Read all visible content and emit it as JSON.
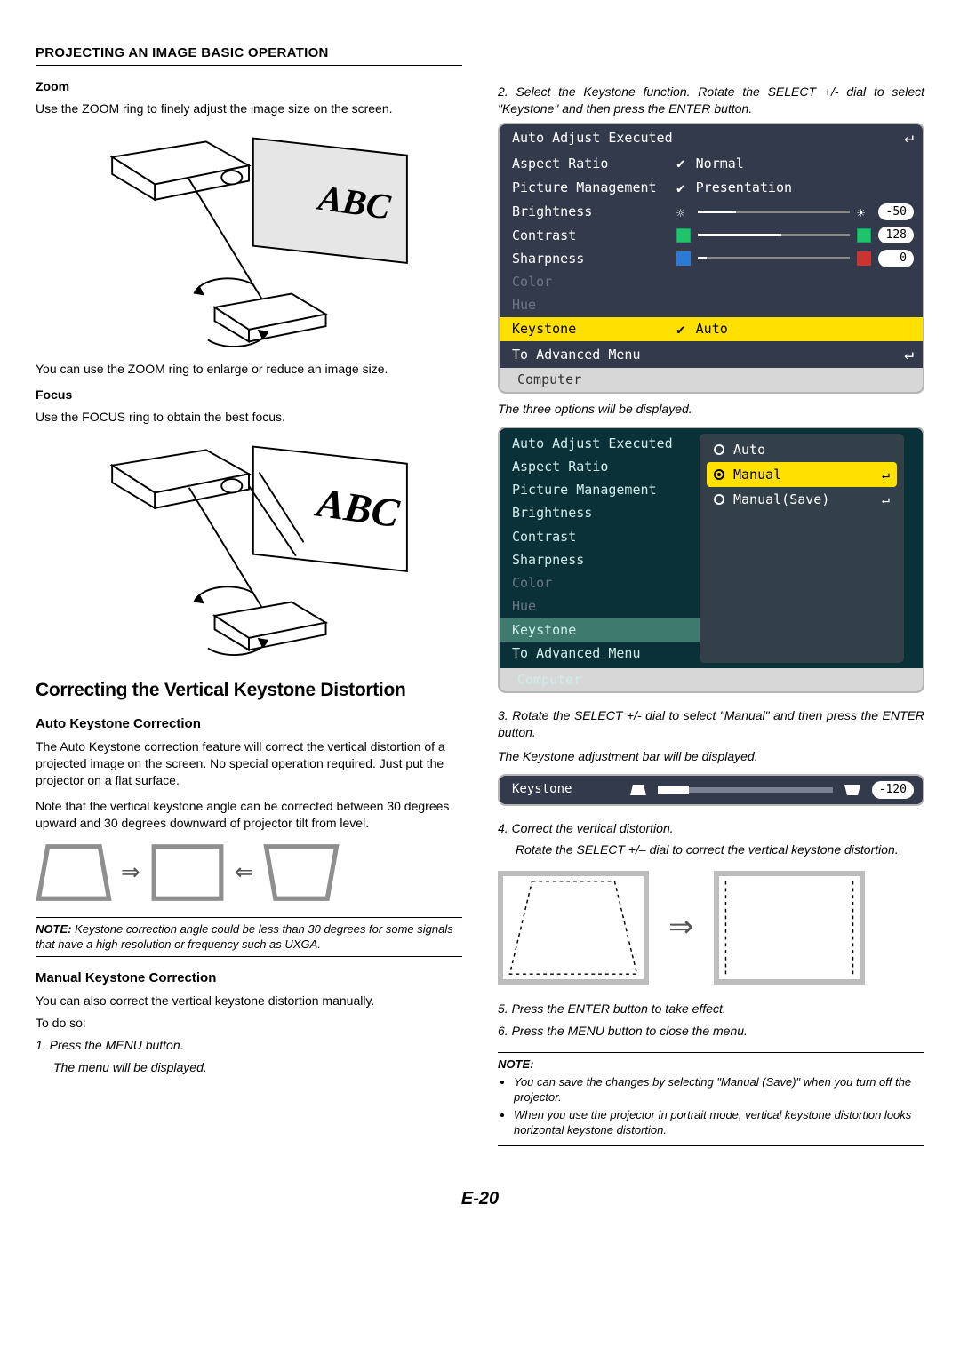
{
  "header": "PROJECTING AN IMAGE BASIC OPERATION",
  "left": {
    "zoom_h": "Zoom",
    "zoom_p": "Use the ZOOM ring to finely adjust the image size on the screen.",
    "zoom_cap": "You can use the ZOOM ring to enlarge or reduce an image size.",
    "focus_h": "Focus",
    "focus_p": "Use the FOCUS ring to obtain the best focus.",
    "big_h": "Correcting the Vertical Keystone Distortion",
    "auto_h": "Auto Keystone Correction",
    "auto_p1": "The Auto Keystone correction feature will correct the vertical distortion of a projected image on the screen. No special operation required. Just put the projector on a flat surface.",
    "auto_p2": "Note that the vertical keystone angle can be corrected between 30 degrees upward and 30 degrees downward of projector tilt from level.",
    "note1_label": "NOTE:",
    "note1_text": " Keystone correction angle could be less than 30 degrees for some signals that have a high resolution or frequency such as UXGA.",
    "manual_h": "Manual Keystone Correction",
    "manual_p1": "You can also correct the vertical keystone distortion manually.",
    "manual_p2": "To do so:",
    "step1a": "1.  Press the MENU button.",
    "step1b": "The menu will be displayed."
  },
  "right": {
    "step2": "2. Select the Keystone function. Rotate the SELECT +/- dial to select \"Keystone\" and then press the ENTER button.",
    "cap_three": "The three options will be displayed.",
    "step3": "3. Rotate the SELECT +/- dial to select \"Manual\" and then press the ENTER button.",
    "cap_bar": "The Keystone adjustment bar will be displayed.",
    "step4a": "4. Correct the vertical distortion.",
    "step4b": "Rotate the SELECT +/– dial to correct the vertical keystone distortion.",
    "step5": "5.  Press the ENTER button to take effect.",
    "step6": "6.  Press the MENU button to close the menu.",
    "note_head": "NOTE:",
    "note_b1": "You can save the changes by selecting \"Manual (Save)\" when you turn off the projector.",
    "note_b2": "When you use the projector in portrait mode, vertical keystone distortion looks horizontal keystone distortion."
  },
  "menu1": {
    "r0": "Auto Adjust Executed",
    "r1": "Aspect Ratio",
    "v1": "Normal",
    "r2": "Picture Management",
    "v2": "Presentation",
    "r3": "Brightness",
    "v3": "-50",
    "r4": "Contrast",
    "v4": "128",
    "r5": "Sharpness",
    "v5": "0",
    "r6": "Color",
    "r7": "Hue",
    "r8": "Keystone",
    "v8": "Auto",
    "r9": "To Advanced Menu",
    "src": "Computer"
  },
  "menu2": {
    "l0": "Auto Adjust Executed",
    "l1": "Aspect Ratio",
    "l2": "Picture Management",
    "l3": "Brightness",
    "l4": "Contrast",
    "l5": "Sharpness",
    "l6": "Color",
    "l7": "Hue",
    "l8": "Keystone",
    "l9": "To Advanced Menu",
    "o0": "Auto",
    "o1": "Manual",
    "o2": "Manual(Save)",
    "src": "Computer"
  },
  "kbar": {
    "label": "Keystone",
    "val": "-120"
  },
  "page": "E-20",
  "draw": {
    "abc": "ABC"
  }
}
